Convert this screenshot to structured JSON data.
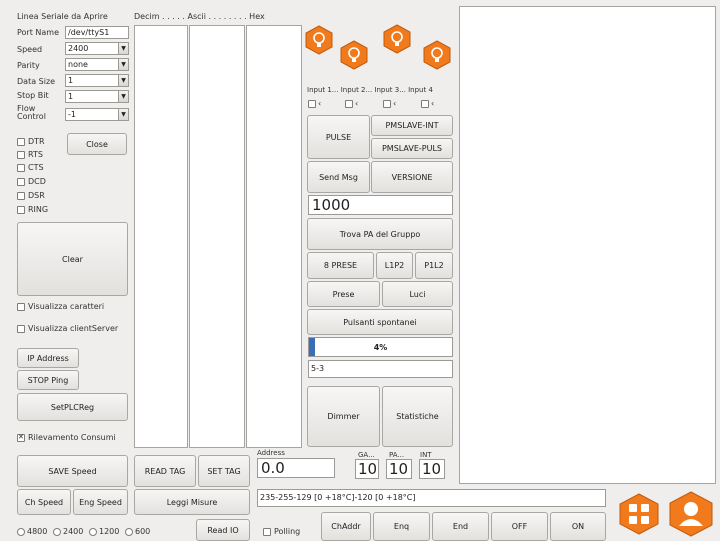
{
  "serial": {
    "header_linea": "Linea Seriale da Aprire",
    "header_decim": "Decim . . . . . Ascii . . . . . . . . Hex",
    "port_name_label": "Port Name",
    "port_name_value": "/dev/ttyS1",
    "speed_label": "Speed",
    "speed_value": "2400",
    "parity_label": "Parity",
    "parity_value": "none",
    "data_size_label": "Data Size",
    "data_size_value": "1",
    "stop_bit_label": "Stop Bit",
    "stop_bit_value": "1",
    "flow_control_label": "Flow Control",
    "flow_control_value": "-1",
    "close_label": "Close",
    "signals": [
      "DTR",
      "RTS",
      "CTS",
      "DCD",
      "DSR",
      "RING"
    ],
    "clear_label": "Clear"
  },
  "options": {
    "visualizza_caratteri": "Visualizza caratteri",
    "visualizza_client": "Visualizza clientServer",
    "ip_address": "IP Address",
    "stop_ping": "STOP Ping",
    "setplcreg": "SetPLCReg",
    "rilevamento": "Rilevamento Consumi"
  },
  "bottom_left": {
    "save_speed": "SAVE Speed",
    "ch_speed": "Ch Speed",
    "eng_speed": "Eng Speed",
    "read_tag": "READ TAG",
    "set_tag": "SET TAG",
    "leggi_misure": "Leggi Misure",
    "read_io": "Read IO",
    "baud_options": [
      "4800",
      "2400",
      "1200",
      "600"
    ]
  },
  "inputs": {
    "labels": [
      "Input 1",
      "Input 2",
      "Input 3",
      "Input 4"
    ],
    "display": "Input 1... Input 2... Input 3... Input 4"
  },
  "controls": {
    "pulse": "PULSE",
    "pmslave_int": "PMSLAVE-INT",
    "pmslave_puls": "PMSLAVE-PULS",
    "send_msg": "Send Msg",
    "versione": "VERSIONE",
    "value_field": "1000",
    "trova_pa": "Trova PA del Gruppo",
    "presse_8": "8 PRESE",
    "l1p2": "L1P2",
    "p1l2": "P1L2",
    "prese": "Prese",
    "luci": "Luci",
    "pulsanti": "Pulsanti spontanei",
    "progress_percent": 4,
    "progress_label": "4%",
    "status_field": "5-3",
    "dimmer": "Dimmer",
    "statistiche": "Statistiche"
  },
  "address": {
    "address_label": "Address",
    "address_value": "0.0",
    "ga_label": "GA...",
    "pa_label": "PA...",
    "int_label": "INT",
    "ga_value": "10",
    "pa_value": "10",
    "int_value": "10",
    "command_line": "235-255-129 [0 +18°C]-120 [0 +18°C]"
  },
  "bottom_bar": {
    "polling": "Polling",
    "chaddr": "ChAddr",
    "enq": "Enq",
    "end": "End",
    "off": "OFF",
    "on": "ON"
  },
  "colors": {
    "accent_orange": "#f07a1c",
    "progress_blue": "#3a6fb8"
  }
}
